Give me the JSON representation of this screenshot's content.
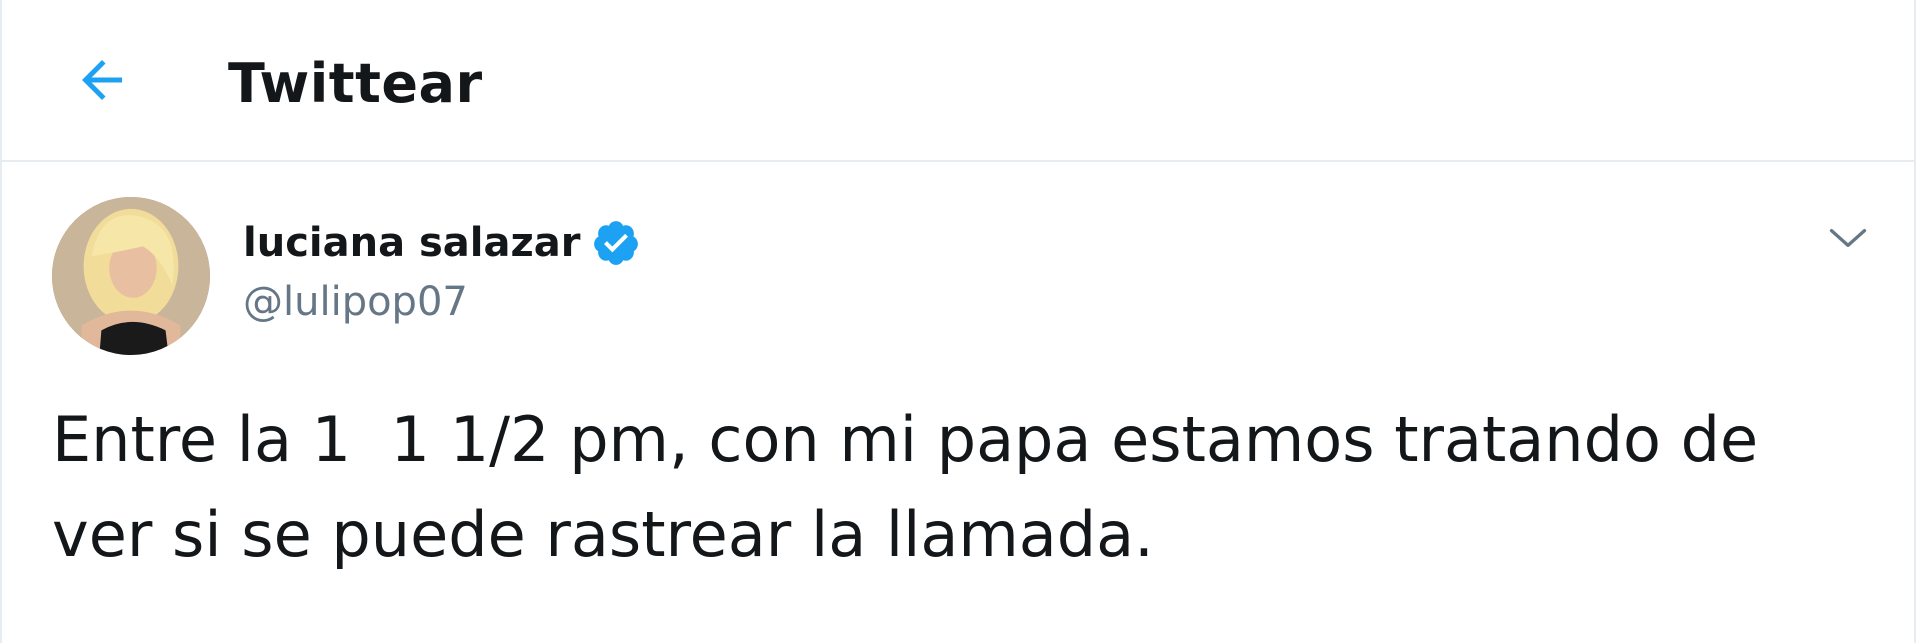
{
  "header": {
    "back_icon": "arrow-left-icon",
    "title": "Twittear"
  },
  "tweet": {
    "avatar_icon": "profile-photo",
    "display_name": "luciana salazar",
    "verified_icon": "verified-badge-icon",
    "handle": "@lulipop07",
    "caret_icon": "chevron-down-icon",
    "text": "Entre la 1  1 1/2 pm, con mi papa estamos tratando de ver si se puede rastrear la llamada."
  },
  "colors": {
    "accent": "#1da1f2",
    "text_primary": "#14171a",
    "text_secondary": "#657786",
    "border": "#e6ecf0"
  }
}
